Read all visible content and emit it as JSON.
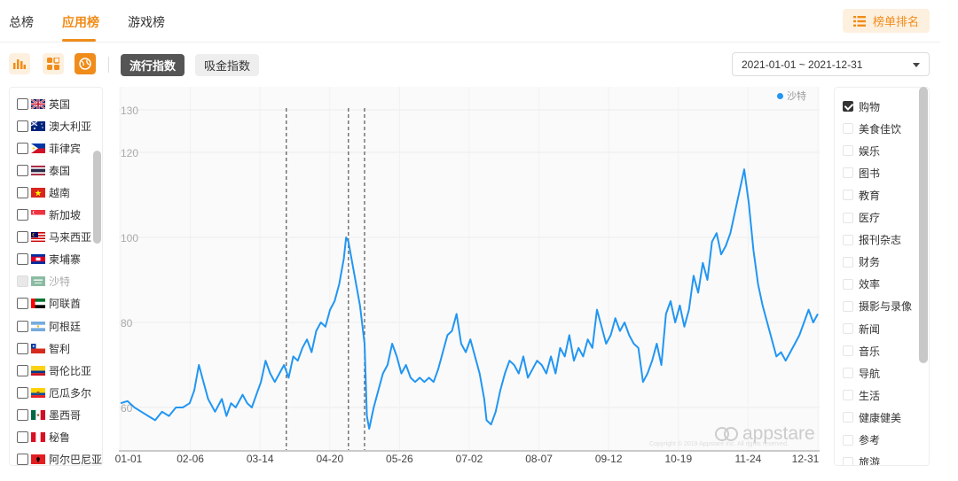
{
  "tabs": [
    {
      "label": "总榜",
      "active": false
    },
    {
      "label": "应用榜",
      "active": true
    },
    {
      "label": "游戏榜",
      "active": false
    }
  ],
  "rank_button": {
    "label": "榜单排名",
    "icon": "list-icon"
  },
  "toolbar": {
    "icons": [
      "bar-chart-icon",
      "grid-icon",
      "globe-icon"
    ],
    "index_buttons": [
      {
        "label": "流行指数",
        "active": true
      },
      {
        "label": "吸金指数",
        "active": false
      }
    ],
    "date_range": "2021-01-01 ~ 2021-12-31"
  },
  "countries": [
    {
      "name": "英国",
      "flag": "gb",
      "checked": false,
      "disabled": false
    },
    {
      "name": "澳大利亚",
      "flag": "au",
      "checked": false,
      "disabled": false
    },
    {
      "name": "菲律宾",
      "flag": "ph",
      "checked": false,
      "disabled": false
    },
    {
      "name": "泰国",
      "flag": "th",
      "checked": false,
      "disabled": false
    },
    {
      "name": "越南",
      "flag": "vn",
      "checked": false,
      "disabled": false
    },
    {
      "name": "新加坡",
      "flag": "sg",
      "checked": false,
      "disabled": false
    },
    {
      "name": "马来西亚",
      "flag": "my",
      "checked": false,
      "disabled": false
    },
    {
      "name": "柬埔寨",
      "flag": "kh",
      "checked": false,
      "disabled": false
    },
    {
      "name": "沙特",
      "flag": "sa",
      "checked": true,
      "disabled": true
    },
    {
      "name": "阿联酋",
      "flag": "ae",
      "checked": false,
      "disabled": false
    },
    {
      "name": "阿根廷",
      "flag": "ar",
      "checked": false,
      "disabled": false
    },
    {
      "name": "智利",
      "flag": "cl",
      "checked": false,
      "disabled": false
    },
    {
      "name": "哥伦比亚",
      "flag": "co",
      "checked": false,
      "disabled": false
    },
    {
      "name": "厄瓜多尔",
      "flag": "ec",
      "checked": false,
      "disabled": false
    },
    {
      "name": "墨西哥",
      "flag": "mx",
      "checked": false,
      "disabled": false
    },
    {
      "name": "秘鲁",
      "flag": "pe",
      "checked": false,
      "disabled": false
    },
    {
      "name": "阿尔巴尼亚",
      "flag": "al",
      "checked": false,
      "disabled": false
    }
  ],
  "categories": [
    {
      "label": "购物",
      "checked": true
    },
    {
      "label": "美食佳饮",
      "checked": false
    },
    {
      "label": "娱乐",
      "checked": false
    },
    {
      "label": "图书",
      "checked": false
    },
    {
      "label": "教育",
      "checked": false
    },
    {
      "label": "医疗",
      "checked": false
    },
    {
      "label": "报刊杂志",
      "checked": false
    },
    {
      "label": "财务",
      "checked": false
    },
    {
      "label": "效率",
      "checked": false
    },
    {
      "label": "摄影与录像",
      "checked": false
    },
    {
      "label": "新闻",
      "checked": false
    },
    {
      "label": "音乐",
      "checked": false
    },
    {
      "label": "导航",
      "checked": false
    },
    {
      "label": "生活",
      "checked": false
    },
    {
      "label": "健康健美",
      "checked": false
    },
    {
      "label": "参考",
      "checked": false
    },
    {
      "label": "旅游",
      "checked": false
    }
  ],
  "watermark": {
    "brand": "appstare",
    "sub": "Copyright © 2019 Appstare Inc. All rights reserved."
  },
  "colors": {
    "accent": "#f08c1a",
    "line": "#2196f3"
  },
  "chart_data": {
    "type": "line",
    "ylim": [
      50,
      130
    ],
    "yticks": [
      130,
      120,
      100,
      80,
      60
    ],
    "xticks": [
      "01-01",
      "02-06",
      "03-14",
      "04-20",
      "05-26",
      "07-02",
      "08-07",
      "09-12",
      "10-19",
      "11-24",
      "12-31"
    ],
    "legend": {
      "position": "top-right"
    },
    "vlines": [
      72,
      99,
      106
    ],
    "series": [
      {
        "name": "沙特",
        "color": "#2196f3",
        "points": [
          [
            0,
            61
          ],
          [
            3,
            61.5
          ],
          [
            6,
            60
          ],
          [
            9,
            59
          ],
          [
            12,
            58
          ],
          [
            15,
            57
          ],
          [
            18,
            59
          ],
          [
            21,
            58
          ],
          [
            24,
            60
          ],
          [
            27,
            60
          ],
          [
            30,
            61
          ],
          [
            32,
            64
          ],
          [
            34,
            70
          ],
          [
            36,
            66
          ],
          [
            38,
            62
          ],
          [
            41,
            59
          ],
          [
            44,
            62
          ],
          [
            46,
            58
          ],
          [
            48,
            61
          ],
          [
            50,
            60
          ],
          [
            53,
            63
          ],
          [
            55,
            61
          ],
          [
            57,
            60
          ],
          [
            59,
            63
          ],
          [
            61,
            66
          ],
          [
            63,
            71
          ],
          [
            65,
            68
          ],
          [
            67,
            66
          ],
          [
            69,
            68
          ],
          [
            71,
            70
          ],
          [
            73,
            67
          ],
          [
            75,
            72
          ],
          [
            77,
            71
          ],
          [
            79,
            74
          ],
          [
            81,
            76
          ],
          [
            83,
            73
          ],
          [
            85,
            78
          ],
          [
            87,
            80
          ],
          [
            89,
            79
          ],
          [
            91,
            83
          ],
          [
            93,
            85
          ],
          [
            95,
            89
          ],
          [
            97,
            95
          ],
          [
            98,
            100
          ],
          [
            99,
            99
          ],
          [
            100,
            96
          ],
          [
            102,
            90
          ],
          [
            104,
            84
          ],
          [
            106,
            75
          ],
          [
            107,
            58
          ],
          [
            108,
            55
          ],
          [
            110,
            60
          ],
          [
            112,
            64
          ],
          [
            114,
            68
          ],
          [
            116,
            70
          ],
          [
            118,
            75
          ],
          [
            120,
            72
          ],
          [
            122,
            68
          ],
          [
            124,
            70
          ],
          [
            126,
            67
          ],
          [
            128,
            66
          ],
          [
            130,
            67
          ],
          [
            132,
            66
          ],
          [
            134,
            67
          ],
          [
            136,
            66
          ],
          [
            138,
            69
          ],
          [
            140,
            73
          ],
          [
            142,
            77
          ],
          [
            144,
            78
          ],
          [
            146,
            82
          ],
          [
            148,
            75
          ],
          [
            150,
            73
          ],
          [
            152,
            76
          ],
          [
            154,
            72
          ],
          [
            156,
            68
          ],
          [
            158,
            62
          ],
          [
            159,
            57
          ],
          [
            161,
            56
          ],
          [
            163,
            59
          ],
          [
            165,
            64
          ],
          [
            167,
            68
          ],
          [
            169,
            71
          ],
          [
            171,
            70
          ],
          [
            173,
            68
          ],
          [
            175,
            72
          ],
          [
            177,
            67
          ],
          [
            179,
            69
          ],
          [
            181,
            71
          ],
          [
            183,
            70
          ],
          [
            185,
            68
          ],
          [
            187,
            72
          ],
          [
            189,
            68
          ],
          [
            191,
            74
          ],
          [
            193,
            72
          ],
          [
            195,
            77
          ],
          [
            197,
            71
          ],
          [
            199,
            74
          ],
          [
            201,
            72
          ],
          [
            203,
            76
          ],
          [
            205,
            74
          ],
          [
            207,
            83
          ],
          [
            209,
            79
          ],
          [
            211,
            75
          ],
          [
            213,
            77
          ],
          [
            215,
            81
          ],
          [
            217,
            78
          ],
          [
            219,
            80
          ],
          [
            221,
            77
          ],
          [
            223,
            75
          ],
          [
            225,
            74
          ],
          [
            227,
            66
          ],
          [
            229,
            68
          ],
          [
            231,
            71
          ],
          [
            233,
            75
          ],
          [
            235,
            70
          ],
          [
            237,
            82
          ],
          [
            239,
            85
          ],
          [
            241,
            80
          ],
          [
            243,
            84
          ],
          [
            245,
            79
          ],
          [
            247,
            83
          ],
          [
            249,
            91
          ],
          [
            251,
            87
          ],
          [
            253,
            94
          ],
          [
            255,
            90
          ],
          [
            257,
            99
          ],
          [
            259,
            101
          ],
          [
            261,
            96
          ],
          [
            263,
            98
          ],
          [
            265,
            101
          ],
          [
            267,
            106
          ],
          [
            269,
            111
          ],
          [
            271,
            116
          ],
          [
            273,
            108
          ],
          [
            275,
            97
          ],
          [
            277,
            89
          ],
          [
            279,
            84
          ],
          [
            281,
            80
          ],
          [
            283,
            76
          ],
          [
            285,
            72
          ],
          [
            287,
            73
          ],
          [
            289,
            71
          ],
          [
            291,
            73
          ],
          [
            293,
            75
          ],
          [
            295,
            77
          ],
          [
            297,
            80
          ],
          [
            299,
            83
          ],
          [
            301,
            80
          ],
          [
            303,
            82
          ]
        ]
      }
    ]
  }
}
